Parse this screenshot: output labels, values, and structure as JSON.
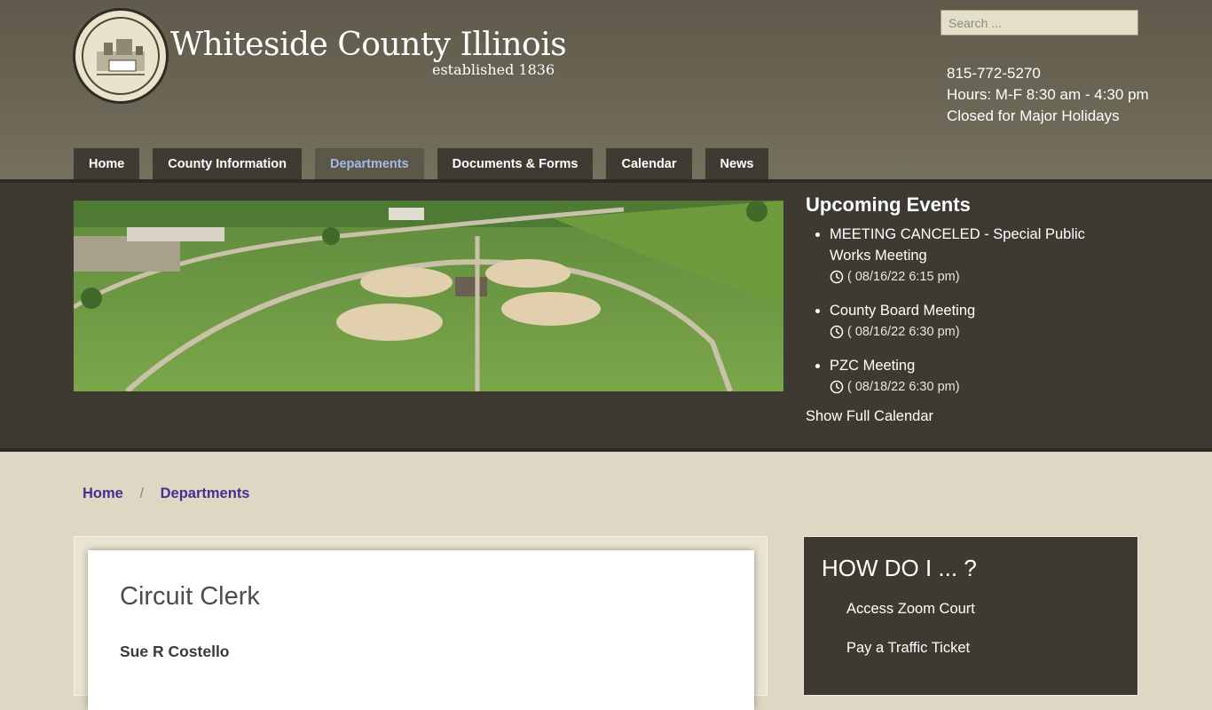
{
  "site": {
    "title": "Whiteside County Illinois",
    "subtitle": "established 1836"
  },
  "search": {
    "placeholder": "Search ..."
  },
  "contact": {
    "phone": "815-772-5270",
    "hours": "Hours: M-F 8:30 am - 4:30 pm",
    "closed": "Closed for Major Holidays"
  },
  "nav": {
    "items": [
      {
        "label": "Home"
      },
      {
        "label": "County Information"
      },
      {
        "label": "Departments"
      },
      {
        "label": "Documents & Forms"
      },
      {
        "label": "Calendar"
      },
      {
        "label": "News"
      }
    ],
    "active": "Departments"
  },
  "events": {
    "heading": "Upcoming Events",
    "items": [
      {
        "title": "MEETING CANCELED - Special Public Works Meeting",
        "when": "( 08/16/22 6:15 pm)"
      },
      {
        "title": "County Board Meeting",
        "when": "( 08/16/22 6:30 pm)"
      },
      {
        "title": "PZC Meeting",
        "when": "( 08/18/22 6:30 pm)"
      }
    ],
    "show_full": "Show Full Calendar"
  },
  "breadcrumb": {
    "home": "Home",
    "current": "Departments",
    "separator": "/"
  },
  "content": {
    "title": "Circuit Clerk",
    "name": "Sue R Costello"
  },
  "howdo": {
    "heading": "HOW DO I ... ?",
    "links": [
      {
        "label": "Access Zoom Court"
      },
      {
        "label": "Pay a Traffic Ticket"
      }
    ]
  },
  "colors": {
    "header_bg": "#6b6655",
    "band_bg": "#3d3a31",
    "page_bg": "#ddd7c4",
    "link": "#4b2c91",
    "nav_active_text": "#a8b8e8"
  }
}
